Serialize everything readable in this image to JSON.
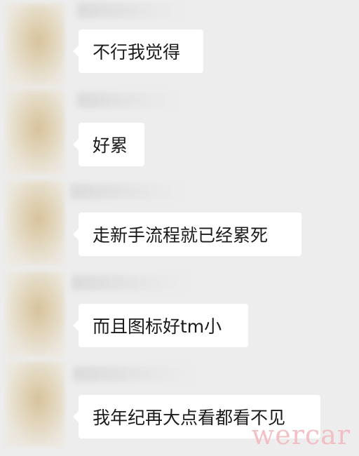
{
  "messages": [
    {
      "text": "不行我觉得"
    },
    {
      "text": "好累"
    },
    {
      "text": "走新手流程就已经累死"
    },
    {
      "text": "而且图标好tm小"
    },
    {
      "text": "我年纪再大点看都看不见"
    }
  ],
  "watermark": "wercar"
}
